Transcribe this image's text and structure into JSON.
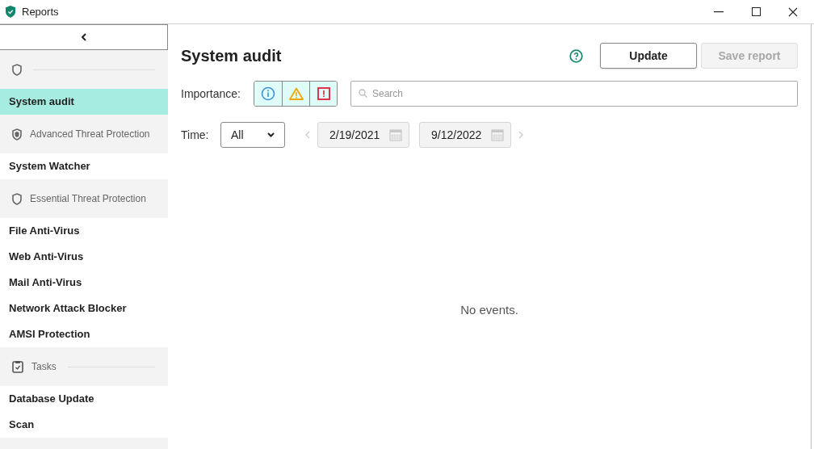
{
  "window": {
    "title": "Reports"
  },
  "sidebar": {
    "groups": [
      {
        "items": [
          {
            "label": "System audit",
            "selected": true
          }
        ]
      },
      {
        "label": "Advanced Threat Protection",
        "items": [
          {
            "label": "System Watcher",
            "selected": false
          }
        ]
      },
      {
        "label": "Essential Threat Protection",
        "items": [
          {
            "label": "File Anti-Virus",
            "selected": false
          },
          {
            "label": "Web Anti-Virus",
            "selected": false
          },
          {
            "label": "Mail Anti-Virus",
            "selected": false
          },
          {
            "label": "Network Attack Blocker",
            "selected": false
          },
          {
            "label": "AMSI Protection",
            "selected": false
          }
        ]
      },
      {
        "label": "Tasks",
        "items": [
          {
            "label": "Database Update",
            "selected": false
          },
          {
            "label": "Scan",
            "selected": false
          }
        ]
      }
    ]
  },
  "main": {
    "title": "System audit",
    "buttons": [
      {
        "label": "Update",
        "disabled": false
      },
      {
        "label": "Save report",
        "disabled": true
      }
    ],
    "importance": {
      "label": "Importance:",
      "levels": [
        {
          "kind": "info",
          "selected": true
        },
        {
          "kind": "warning",
          "selected": true
        },
        {
          "kind": "critical",
          "selected": true
        }
      ]
    },
    "search": {
      "placeholder": "Search"
    },
    "time": {
      "label": "Time:",
      "value": "All",
      "from": "2/19/2021",
      "to": "9/12/2022"
    },
    "empty_message": "No events."
  }
}
